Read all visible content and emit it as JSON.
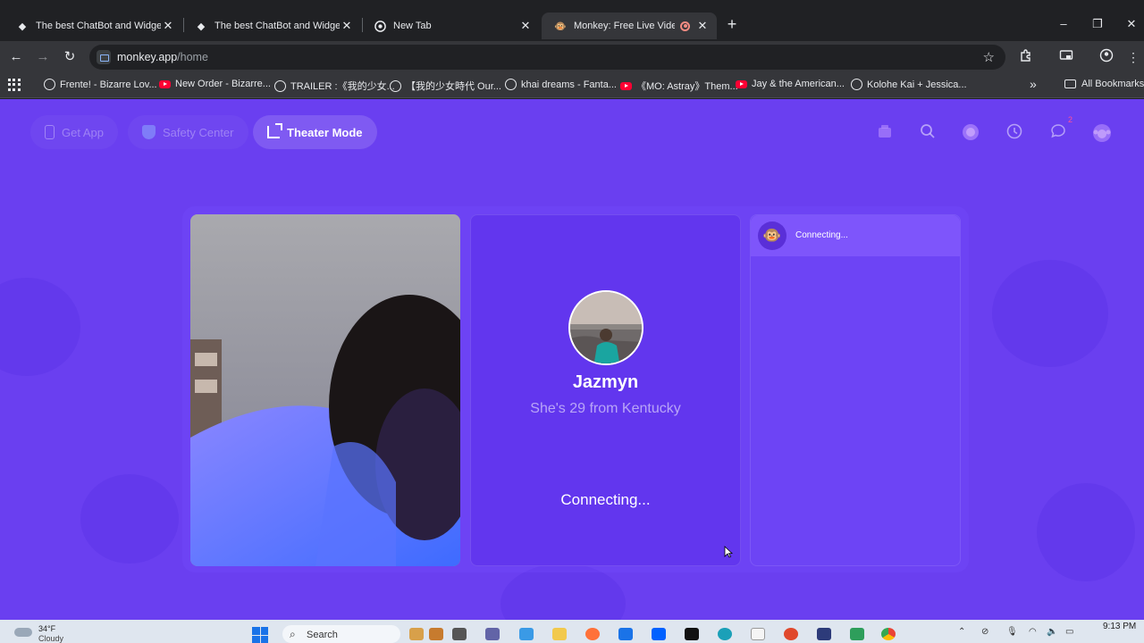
{
  "browser": {
    "tabs": [
      {
        "title": "The best ChatBot and Widgets",
        "active": false,
        "favicon": "diamond-icon"
      },
      {
        "title": "The best ChatBot and Widgets",
        "active": false,
        "favicon": "diamond-icon"
      },
      {
        "title": "New Tab",
        "active": false,
        "favicon": "chrome-icon"
      },
      {
        "title": "Monkey: Free Live Video Ch",
        "active": true,
        "favicon": "monkey-icon",
        "recording": true
      }
    ],
    "new_tab_glyph": "+",
    "window_controls": {
      "minimize": "–",
      "restore": "❐",
      "close": "✕"
    },
    "url": {
      "host": "monkey.app",
      "path": "/home"
    },
    "nav": {
      "back": "←",
      "forward": "→",
      "reload": "↻"
    },
    "bookmarks": [
      {
        "label": "Frente! - Bizarre Lov...",
        "icon": "globe"
      },
      {
        "label": "New Order - Bizarre...",
        "icon": "yt"
      },
      {
        "label": "TRAILER :《我的少女...",
        "icon": "globe"
      },
      {
        "label": "【我的少女時代 Our...",
        "icon": "globe"
      },
      {
        "label": "khai dreams - Fanta...",
        "icon": "globe"
      },
      {
        "label": "《MO: Astray》Them...",
        "icon": "yt"
      },
      {
        "label": "Jay & the American...",
        "icon": "yt"
      },
      {
        "label": "Kolohe Kai + Jessica...",
        "icon": "globe"
      }
    ],
    "bookmarks_overflow": "»",
    "all_bookmarks": "All Bookmarks"
  },
  "page": {
    "nav": {
      "get_app": "Get App",
      "safety_center": "Safety Center",
      "theater_mode": "Theater Mode"
    },
    "notification_count": "2",
    "match": {
      "name": "Jazmyn",
      "subtitle": "She's 29 from Kentucky",
      "status": "Connecting..."
    },
    "chat": {
      "status": "Connecting...",
      "avatar_glyph": "🐵"
    }
  },
  "taskbar": {
    "weather_temp": "34°F",
    "weather_desc": "Cloudy",
    "search_placeholder": "Search",
    "time": "9:13 PM"
  },
  "colors": {
    "page_bg": "#6a3ff0",
    "browser_dark": "#202124",
    "toolbar": "#35363a",
    "taskbar": "#dfe6ef"
  }
}
